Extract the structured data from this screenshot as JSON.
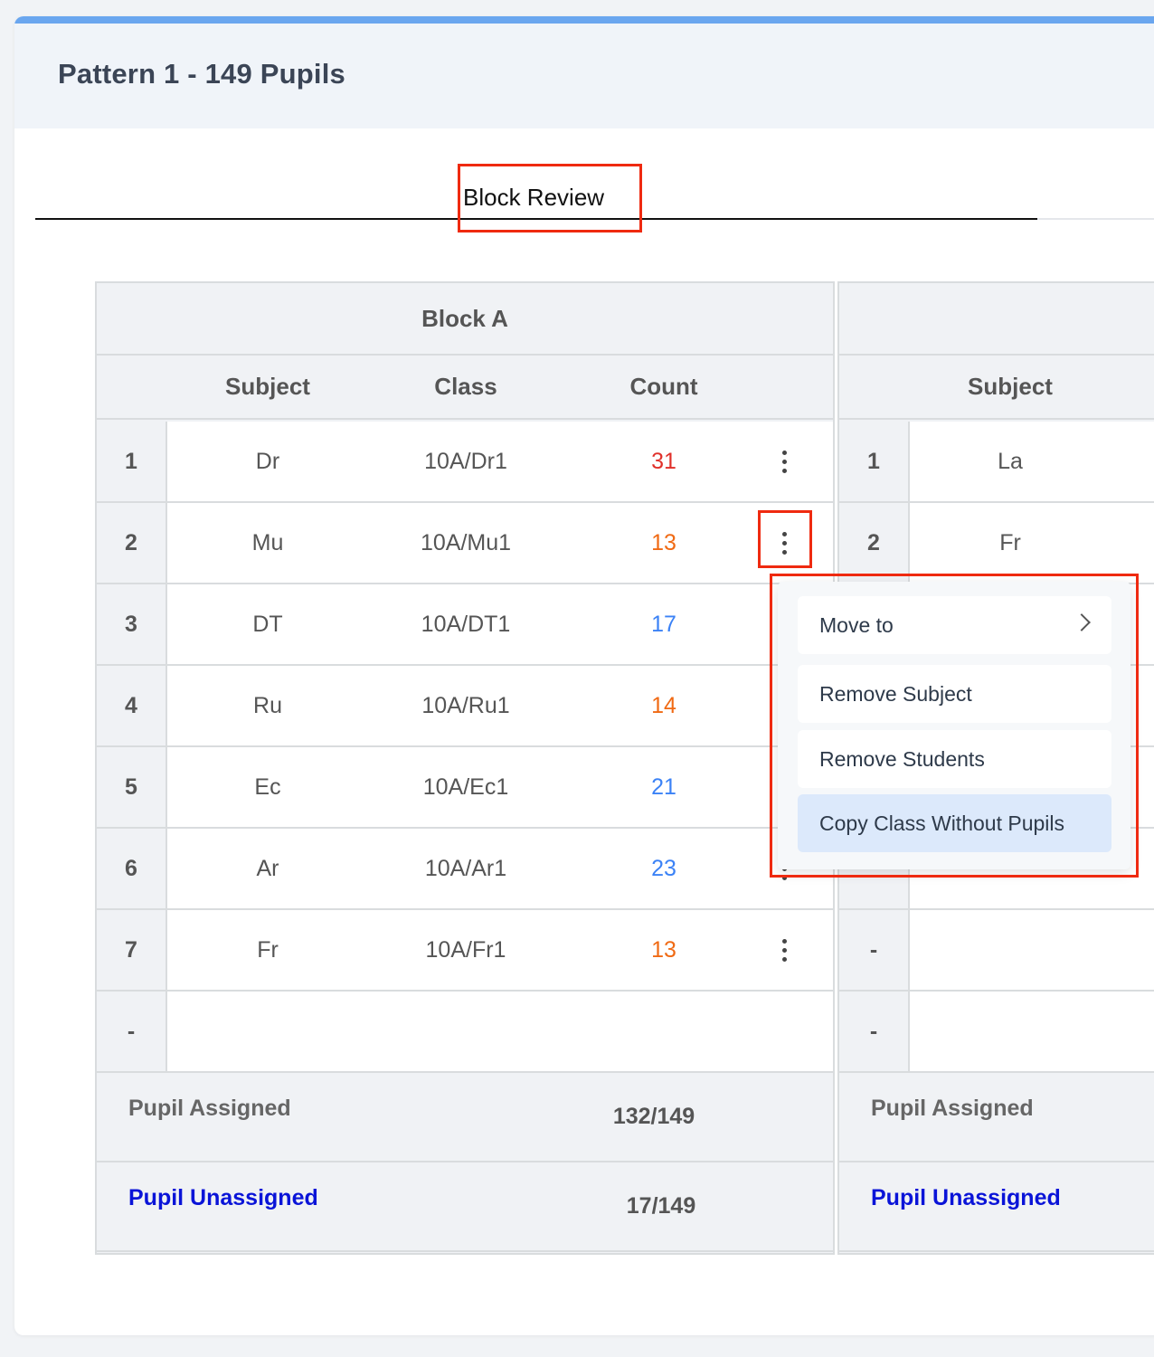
{
  "page": {
    "title": "Pattern 1 - 149 Pupils"
  },
  "tab": {
    "label": "Block Review"
  },
  "colors": {
    "red": "#e0302a",
    "orange": "#f06a14",
    "blue": "#3b82f6",
    "link": "#0a14d8",
    "highlight": "#ef2a10"
  },
  "blocks": [
    {
      "title": "Block A",
      "headers": {
        "subject": "Subject",
        "class": "Class",
        "count": "Count"
      },
      "rows": [
        {
          "num": "1",
          "subject": "Dr",
          "class": "10A/Dr1",
          "count": "31",
          "count_color": "#e0302a"
        },
        {
          "num": "2",
          "subject": "Mu",
          "class": "10A/Mu1",
          "count": "13",
          "count_color": "#f06a14"
        },
        {
          "num": "3",
          "subject": "DT",
          "class": "10A/DT1",
          "count": "17",
          "count_color": "#3b82f6"
        },
        {
          "num": "4",
          "subject": "Ru",
          "class": "10A/Ru1",
          "count": "14",
          "count_color": "#f06a14"
        },
        {
          "num": "5",
          "subject": "Ec",
          "class": "10A/Ec1",
          "count": "21",
          "count_color": "#3b82f6"
        },
        {
          "num": "6",
          "subject": "Ar",
          "class": "10A/Ar1",
          "count": "23",
          "count_color": "#3b82f6"
        },
        {
          "num": "7",
          "subject": "Fr",
          "class": "10A/Fr1",
          "count": "13",
          "count_color": "#f06a14"
        },
        {
          "num": "-",
          "subject": "",
          "class": "",
          "count": ""
        }
      ],
      "footer": {
        "assigned_label": "Pupil Assigned",
        "assigned_value": "132/149",
        "unassigned_label": "Pupil Unassigned",
        "unassigned_value": "17/149"
      }
    },
    {
      "title": "",
      "headers": {
        "subject": "Subject"
      },
      "rows": [
        {
          "num": "1",
          "subject": "La"
        },
        {
          "num": "2",
          "subject": "Fr"
        },
        {
          "num": "",
          "subject": ""
        },
        {
          "num": "",
          "subject": ""
        },
        {
          "num": "",
          "subject": ""
        },
        {
          "num": "",
          "subject": ""
        },
        {
          "num": "-",
          "subject": ""
        },
        {
          "num": "-",
          "subject": ""
        }
      ],
      "footer": {
        "assigned_label": "Pupil Assigned",
        "unassigned_label": "Pupil Unassigned"
      }
    }
  ],
  "context_menu": {
    "items": [
      {
        "label": "Move to",
        "has_submenu": true
      },
      {
        "label": "Remove Subject"
      },
      {
        "label": "Remove Students"
      },
      {
        "label": "Copy Class Without Pupils",
        "active": true
      }
    ]
  }
}
